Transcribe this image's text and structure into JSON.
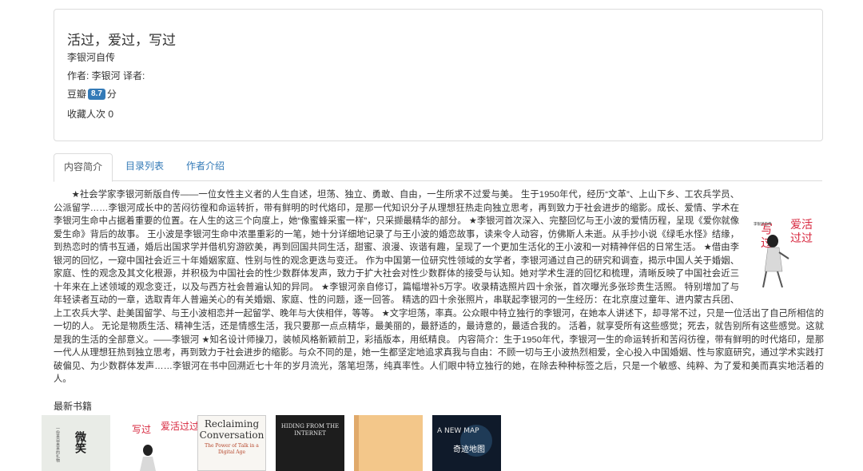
{
  "book": {
    "title": "活过，爱过，写过",
    "subtitle": "李银河自传",
    "author_line": "作者: 李银河 译者:",
    "rating_prefix": "豆瓣",
    "rating_value": "8.7",
    "rating_suffix": "分",
    "favorites": "收藏人次 0"
  },
  "tabs": [
    {
      "label": "内容简介",
      "active": true
    },
    {
      "label": "目录列表",
      "active": false
    },
    {
      "label": "作者介绍",
      "active": false
    }
  ],
  "intro_text": "★社会学家李银河新版自传——一位女性主义者的人生自述，坦荡、独立、勇敢、自由，一生所求不过爱与美。 生于1950年代，经历“文革”、上山下乡、工农兵学员、公派留学……李银河成长中的苦闷彷徨和命运转折，带有鲜明的时代烙印，是那一代知识分子从理想狂热走向独立思考，再到致力于社会进步的缩影。成长、爱情、学术在李银河生命中占据着重要的位置。在人生的这三个向度上，她“像蜜蜂采蜜一样”，只采撷最精华的部分。 ★李银河首次深入、完整回忆与王小波的爱情历程，呈现《爱你就像爱生命》背后的故事。 王小波是李银河生命中浓墨重彩的一笔，她十分详细地记录了与王小波的婚恋故事，读来令人动容，仿佛斯人未逝。从手抄小说《绿毛水怪》结缘，到热恋时的情书互通，婚后出国求学并借机穷游欧美，再到回国共同生活，甜蜜、浪漫、诙谐有趣，呈现了一个更加生活化的王小波和一对精神伴侣的日常生活。 ★借由李银河的回忆，一窥中国社会近三十年婚姻家庭、性别与性的观念更迭与变迁。 作为中国第一位研究性领域的女学者，李银河通过自己的研究和调查，揭示中国人关于婚姻、家庭、性的观念及其文化根源，并积极为中国社会的性少数群体发声，致力于扩大社会对性少数群体的接受与认知。她对学术生涯的回忆和梳理，清晰反映了中国社会近三十年来在上述领域的观念变迁，以及与西方社会普遍认知的异同。 ★李银河亲自修订，篇幅增补5万字。收录精选照片四十余张，首次曝光多张珍贵生活照。 特别增加了与年轻读者互动的一章，选取青年人普遍关心的有关婚姻、家庭、性的问题，逐一回答。 精选的四十余张照片，串联起李银河的一生经历：在北京度过童年、进内蒙古兵团、上工农兵大学、赴美国留学、与王小波相恋并一起留学、晚年与大侠相伴，等等。 ★文字坦荡，率真。公众眼中特立独行的李银河，在她本人讲述下，却寻常不过，只是一位活出了自己所相信的一切的人。 无论是物质生活、精神生活，还是情感生活，我只要那一点点精华，最美丽的，最舒适的，最诗意的，最适合我的。 活着，就享受所有这些感觉；死去，就告别所有这些感觉。这就是我的生活的全部意义。——李银河 ★知名设计师操刀，装帧风格新颖前卫，彩插版本，用纸精良。 内容简介：生于1950年代，李银河一生的命运转折和苦闷彷徨，带有鲜明的时代烙印，是那一代人从理想狂热到独立思考，再到致力于社会进步的缩影。与众不同的是，她一生都坚定地追求真我与自由：不顾一切与王小波热烈相爱，全心投入中国婚姻、性与家庭研究，通过学术实践打破偏见、为少数群体发声……李银河在书中回溯近七十年的岁月流光，落笔坦荡，纯真率性。人们眼中特立独行的她，在除去种种标签之后，只是一个敏感、纯粹、为了爱和美而真实地活着的人。",
  "cover": {
    "title_a": "写",
    "title_b": "过",
    "title_c": "爱活",
    "title_d": "过过",
    "author": "李银河自传"
  },
  "latest_heading": "最新书籍",
  "latest_books": [
    {
      "cover_text": "微笑",
      "sub": "一份来自未来的礼物"
    },
    {
      "cover_text": "写过",
      "sub": "爱活过过"
    },
    {
      "cover_text": "Reclaiming Conversation",
      "sub": "The Power of Talk in a Digital Age"
    },
    {
      "cover_text": "HIDING FROM THE INTERNET",
      "sub": ""
    },
    {
      "cover_text": "",
      "sub": ""
    },
    {
      "cover_text": "A NEW MAP",
      "sub": "奇迹地图"
    }
  ],
  "colors": {
    "link": "#337ab7",
    "badge": "#337ab7",
    "accent_red": "#d7263d"
  }
}
